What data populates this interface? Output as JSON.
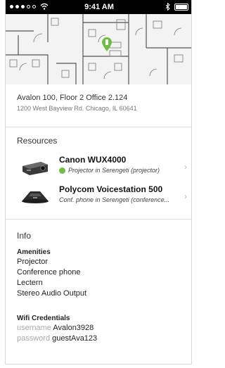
{
  "status_bar": {
    "time": "9:41 AM",
    "icons": [
      "signal-dots",
      "wifi-icon",
      "bluetooth-icon",
      "battery-icon"
    ]
  },
  "location": {
    "room": "Avalon 100, Floor 2  Office 2.124",
    "address": "1200 West Bayview Rd. Chicago, IL 60641"
  },
  "resources": {
    "title": "Resources",
    "items": [
      {
        "name": "Canon WUX4000",
        "subtitle": "Projector in Serengeti (projector)",
        "status": "available",
        "status_color": "#6ebf3f",
        "icon": "projector-image"
      },
      {
        "name": "Polycom Voicestation 500",
        "subtitle": "Conf. phone in Serengeti (conference...",
        "icon": "conference-phone-image"
      }
    ]
  },
  "info": {
    "title": "Info",
    "amenities_label": "Amenities",
    "amenities": [
      "Projector",
      "Conference phone",
      "Lectern",
      "Stereo Audio Output"
    ],
    "wifi_label": "Wifi Credentials",
    "username_label": "username",
    "username": "Avalon3928",
    "password_label": "password",
    "password": "guestAva123"
  },
  "colors": {
    "accent_green": "#6ebf3f"
  }
}
